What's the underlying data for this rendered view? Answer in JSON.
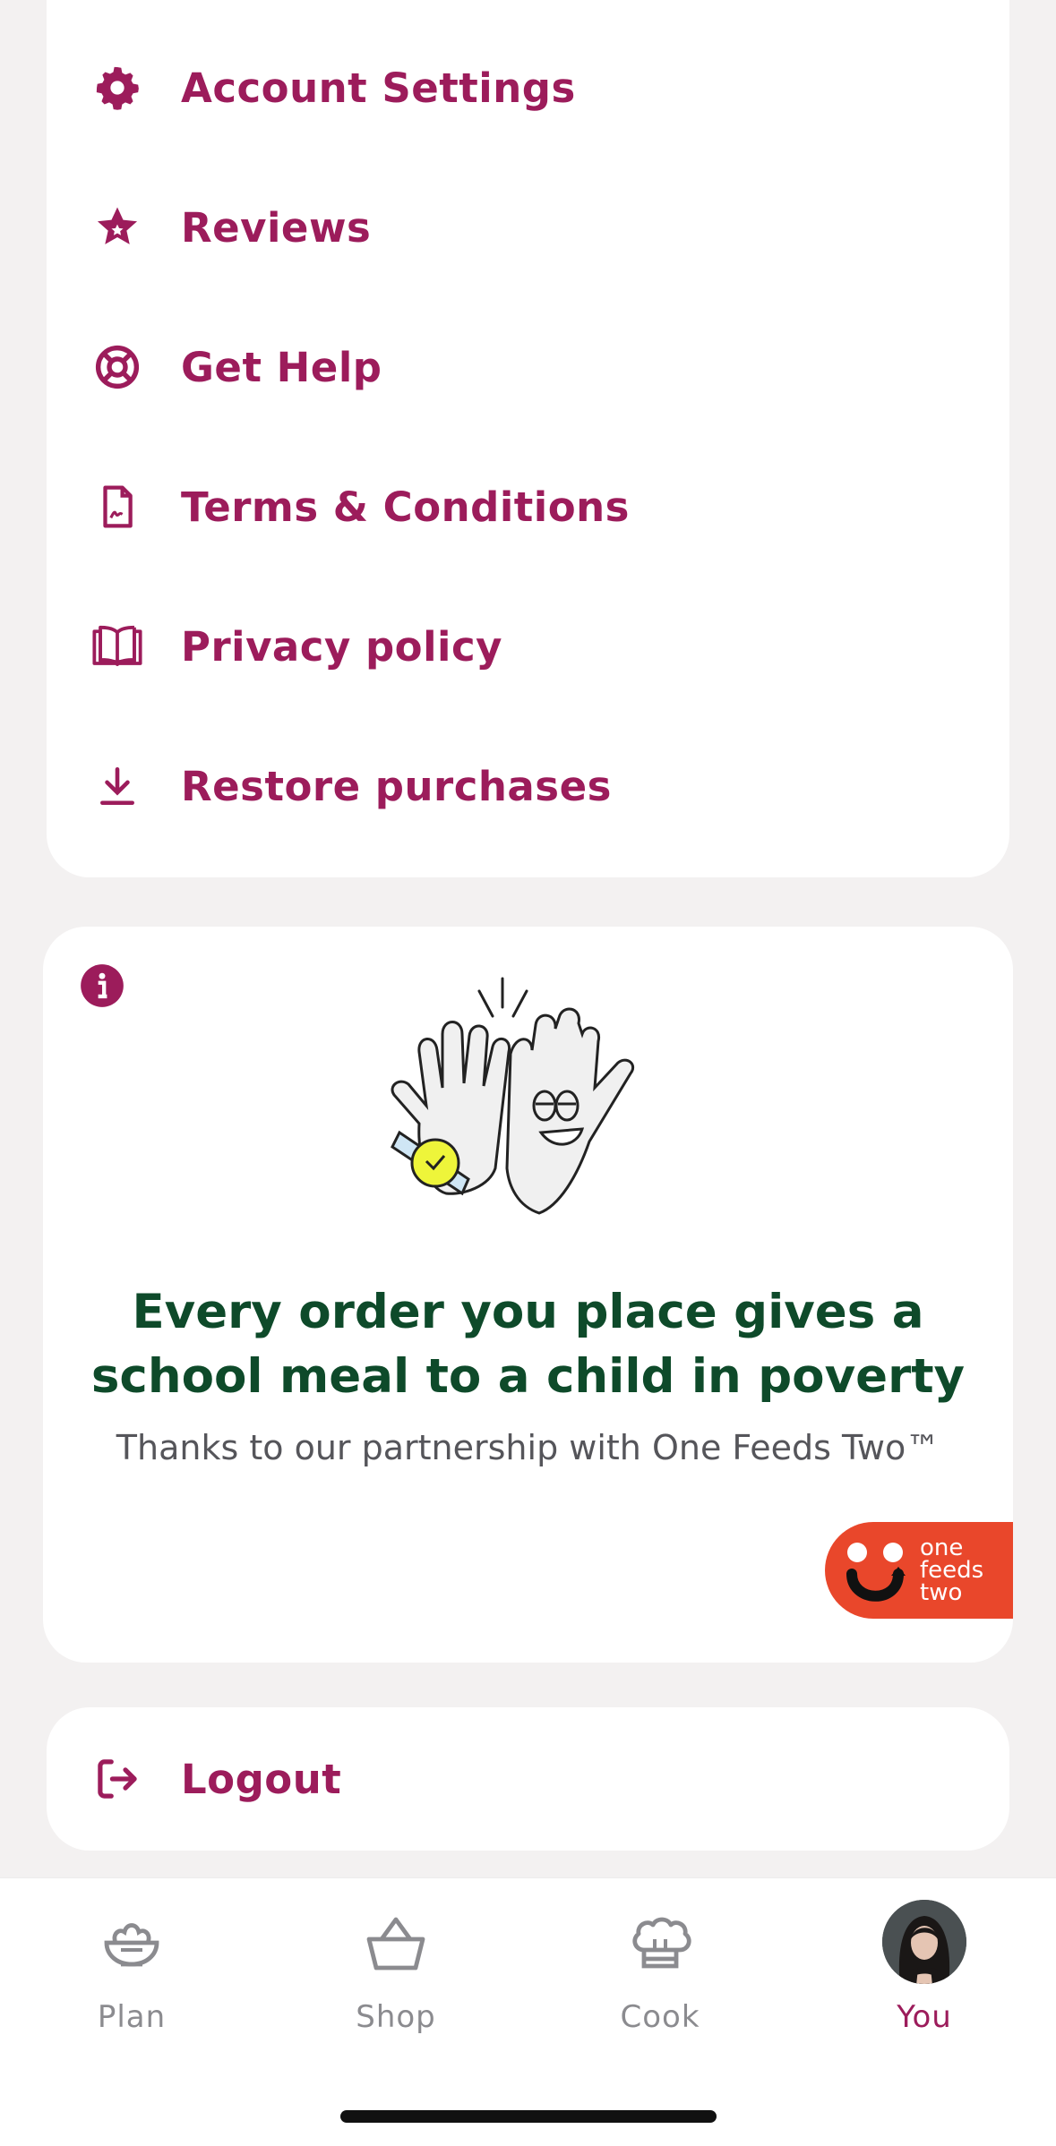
{
  "menu": {
    "items": [
      {
        "label": "Account Settings",
        "icon": "gear-icon"
      },
      {
        "label": "Reviews",
        "icon": "star-icon"
      },
      {
        "label": "Get Help",
        "icon": "lifebuoy-icon"
      },
      {
        "label": "Terms & Conditions",
        "icon": "document-icon"
      },
      {
        "label": "Privacy policy",
        "icon": "book-icon"
      },
      {
        "label": "Restore purchases",
        "icon": "download-icon"
      }
    ]
  },
  "promo": {
    "headline_line1": "Every order you place gives a",
    "headline_line2": "school meal to a child in poverty",
    "subtitle": "Thanks to our partnership with One Feeds Two™",
    "logo_text": [
      "one",
      "feeds",
      "two"
    ]
  },
  "logout": {
    "label": "Logout",
    "icon": "logout-icon"
  },
  "tabbar": {
    "tabs": [
      {
        "label": "Plan",
        "icon": "salad-bowl-icon"
      },
      {
        "label": "Shop",
        "icon": "basket-icon"
      },
      {
        "label": "Cook",
        "icon": "chef-hat-icon"
      },
      {
        "label": "You",
        "icon": "avatar"
      }
    ],
    "active": "You"
  },
  "colors": {
    "accent": "#9c1c5b",
    "headline": "#0e4a2a",
    "logo_bg": "#e9472b",
    "background": "#f3f1f1"
  }
}
